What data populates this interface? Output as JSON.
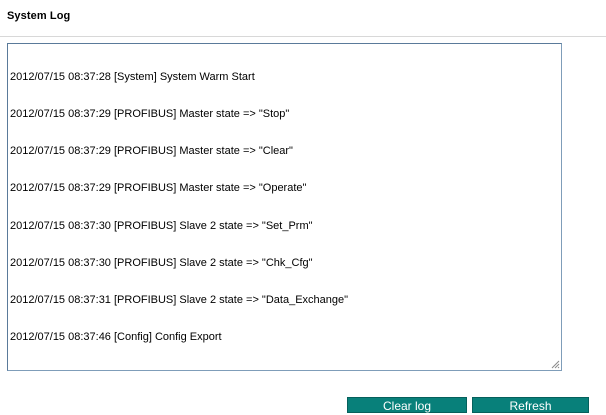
{
  "page": {
    "title": "System Log"
  },
  "log": {
    "lines": [
      "2012/07/15 08:37:28 [System] System Warm Start",
      "2012/07/15 08:37:29 [PROFIBUS] Master state => \"Stop\"",
      "2012/07/15 08:37:29 [PROFIBUS] Master state => \"Clear\"",
      "2012/07/15 08:37:29 [PROFIBUS] Master state => \"Operate\"",
      "2012/07/15 08:37:30 [PROFIBUS] Slave 2 state => \"Set_Prm\"",
      "2012/07/15 08:37:30 [PROFIBUS] Slave 2 state => \"Chk_Cfg\"",
      "2012/07/15 08:37:31 [PROFIBUS] Slave 2 state => \"Data_Exchange\"",
      "2012/07/15 08:37:46 [Config] Config Export"
    ]
  },
  "buttons": {
    "clear_label": "Clear log",
    "refresh_label": "Refresh"
  },
  "colors": {
    "button_bg": "#08807a",
    "button_text": "#ffffff",
    "textarea_border": "#7f9db9"
  },
  "icons": {
    "resize": "resize-grip-icon"
  }
}
